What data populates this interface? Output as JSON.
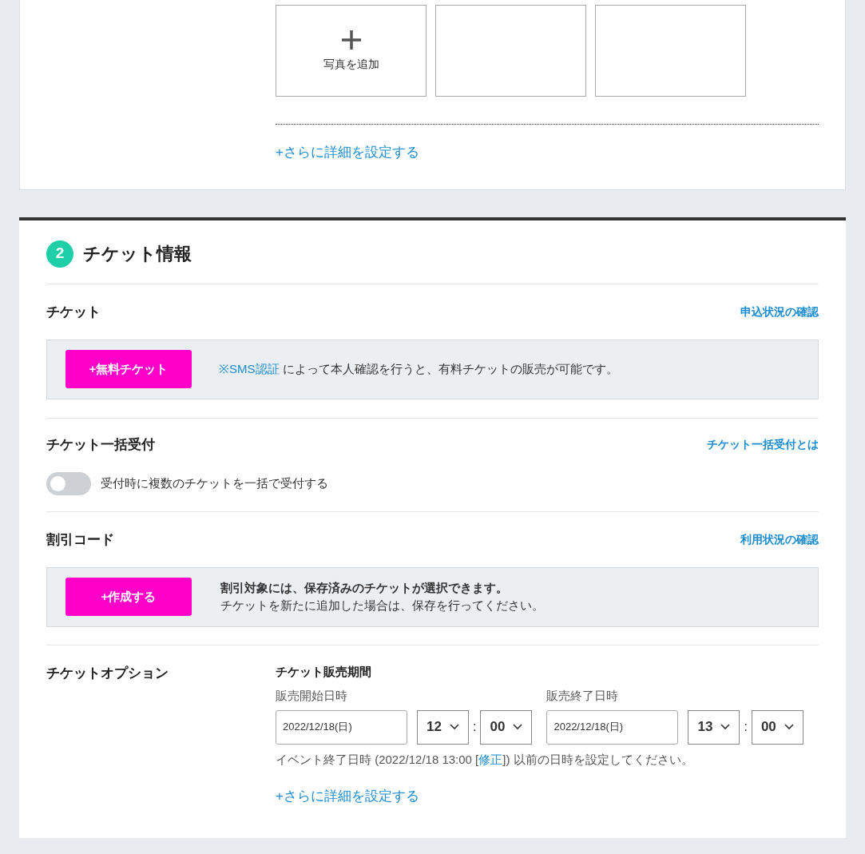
{
  "photos": {
    "tiles": [
      {
        "kind": "add",
        "label": "写真を追加"
      },
      {
        "kind": "empty"
      },
      {
        "kind": "empty"
      }
    ],
    "more_link": "+さらに詳細を設定する"
  },
  "section": {
    "number": "2",
    "title": "チケット情報"
  },
  "ticket": {
    "label": "チケット",
    "link": "申込状況の確認",
    "button": "+無料チケット",
    "note_link": "※SMS認証",
    "note_rest": " によって本人確認を行うと、有料チケットの販売が可能です。"
  },
  "bulk": {
    "label": "チケット一括受付",
    "link": "チケット一括受付とは",
    "toggle": {
      "label": "受付時に複数のチケットを一括で受付する",
      "on": false
    }
  },
  "discount": {
    "label": "割引コード",
    "link": "利用状況の確認",
    "button": "+作成する",
    "note_bold": "割引対象には、保存済みのチケットが選択できます。",
    "note": "チケットを新たに追加した場合は、保存を行ってください。"
  },
  "options": {
    "label": "チケットオプション",
    "period_title": "チケット販売期間",
    "fields": [
      {
        "label": "販売開始日時",
        "date": "2022/12/18(日)",
        "hour": "12",
        "minute": "00"
      },
      {
        "label": "販売終了日時",
        "date": "2022/12/18(日)",
        "hour": "13",
        "minute": "00"
      }
    ],
    "separator": ":",
    "hint_before": "イベント終了日時 (2022/12/18 13:00 [",
    "hint_link": "修正",
    "hint_after": "]) 以前の日時を設定してください。",
    "more_link": "+さらに詳細を設定する"
  }
}
